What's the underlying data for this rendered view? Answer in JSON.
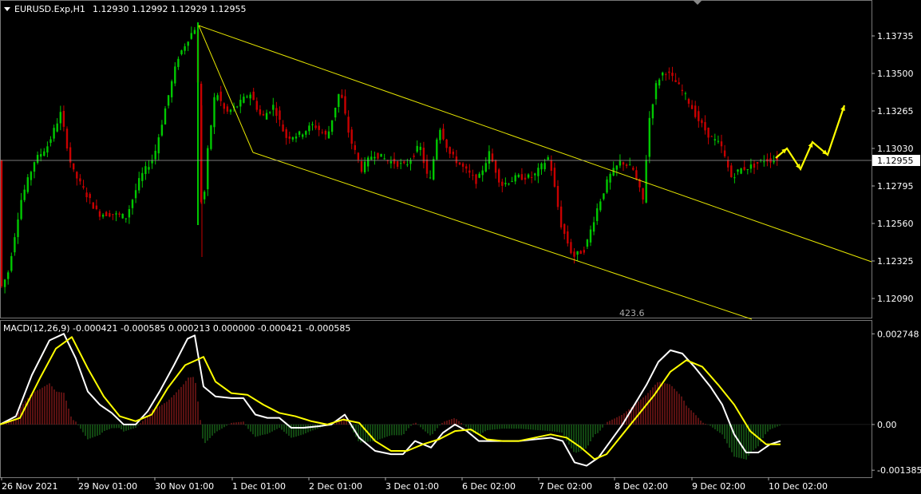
{
  "header": {
    "symbol": "EURUSD.Exp,H1",
    "ohlc": "1.12930 1.12992 1.12929 1.12955"
  },
  "macd_header": "MACD(12,26,9) -0.000421 -0.000585 0.000213 0.000000 -0.000421 -0.000585",
  "chart_label": "423.6",
  "colors": {
    "background": "#000000",
    "bull": "#00c800",
    "bear": "#c80000",
    "channel": "#e6e600",
    "arrow": "#ffff00",
    "macd_line": "#ffffff",
    "signal_line": "#ffff00",
    "hist_pos": "#b22222",
    "hist_neg": "#228b22",
    "bid_line": "#a0a0a0"
  },
  "chart_data": [
    {
      "type": "candlestick",
      "title": "EURUSD.Exp,H1",
      "y_ticks": [
        1.1209,
        1.12325,
        1.1256,
        1.12795,
        1.1303,
        1.13265,
        1.135,
        1.13735
      ],
      "y_tick_labels": [
        "1.12090",
        "1.12325",
        "1.12560",
        "1.12795",
        "1.13030",
        "1.13265",
        "1.13500",
        "1.13735"
      ],
      "ylim": [
        1.12,
        1.1385
      ],
      "current_price": 1.12955,
      "current_price_label": "1.12955",
      "price_path": [
        [
          0,
          1.1212
        ],
        [
          12,
          1.1225
        ],
        [
          28,
          1.127
        ],
        [
          45,
          1.1295
        ],
        [
          62,
          1.1305
        ],
        [
          78,
          1.1325
        ],
        [
          92,
          1.129
        ],
        [
          108,
          1.1276
        ],
        [
          125,
          1.1262
        ],
        [
          142,
          1.1262
        ],
        [
          160,
          1.126
        ],
        [
          178,
          1.1285
        ],
        [
          195,
          1.1298
        ],
        [
          210,
          1.133
        ],
        [
          225,
          1.136
        ],
        [
          238,
          1.1372
        ],
        [
          248,
          1.138
        ],
        [
          255,
          1.1255
        ],
        [
          262,
          1.13
        ],
        [
          272,
          1.134
        ],
        [
          285,
          1.1325
        ],
        [
          300,
          1.133
        ],
        [
          315,
          1.1338
        ],
        [
          330,
          1.1322
        ],
        [
          345,
          1.133
        ],
        [
          360,
          1.131
        ],
        [
          378,
          1.1312
        ],
        [
          395,
          1.1318
        ],
        [
          412,
          1.131
        ],
        [
          428,
          1.134
        ],
        [
          440,
          1.131
        ],
        [
          455,
          1.129
        ],
        [
          470,
          1.13
        ],
        [
          490,
          1.1295
        ],
        [
          510,
          1.1292
        ],
        [
          528,
          1.1305
        ],
        [
          540,
          1.128
        ],
        [
          552,
          1.1318
        ],
        [
          565,
          1.13
        ],
        [
          580,
          1.1292
        ],
        [
          600,
          1.1282
        ],
        [
          615,
          1.13
        ],
        [
          630,
          1.128
        ],
        [
          650,
          1.1285
        ],
        [
          670,
          1.1285
        ],
        [
          690,
          1.1298
        ],
        [
          705,
          1.1255
        ],
        [
          720,
          1.1235
        ],
        [
          735,
          1.124
        ],
        [
          750,
          1.1265
        ],
        [
          765,
          1.1285
        ],
        [
          780,
          1.1295
        ],
        [
          795,
          1.129
        ],
        [
          808,
          1.127
        ],
        [
          815,
          1.132
        ],
        [
          825,
          1.1345
        ],
        [
          835,
          1.1352
        ],
        [
          848,
          1.1345
        ],
        [
          862,
          1.1335
        ],
        [
          878,
          1.132
        ],
        [
          892,
          1.131
        ],
        [
          905,
          1.1305
        ],
        [
          918,
          1.1285
        ],
        [
          930,
          1.129
        ],
        [
          945,
          1.1292
        ],
        [
          960,
          1.1296
        ],
        [
          975,
          1.12955
        ]
      ],
      "channel": {
        "upper": [
          [
            249,
            1.138
          ],
          [
            1092,
            1.1232
          ]
        ],
        "lower": [
          [
            317,
            1.13005
          ],
          [
            942,
            1.1196
          ]
        ],
        "mid_start": [
          [
            317,
            1.13005
          ],
          [
            249,
            1.138
          ]
        ]
      },
      "forecast_arrow": [
        [
          972,
          1.1297
        ],
        [
          986,
          1.1303
        ],
        [
          1003,
          1.129
        ],
        [
          1018,
          1.1307
        ],
        [
          1037,
          1.1299
        ],
        [
          1058,
          1.133
        ]
      ],
      "annotation": {
        "text": "423.6",
        "x": 792,
        "price": 1.1212
      }
    },
    {
      "type": "macd",
      "title": "MACD(12,26,9)",
      "y_ticks": [
        0.002748,
        0.0,
        -0.001385
      ],
      "y_tick_labels": [
        "0.002748",
        "0.00",
        "-0.001385"
      ],
      "ylim": [
        -0.00155,
        0.0029
      ],
      "macd": [
        [
          0,
          0.0
        ],
        [
          20,
          0.00025
        ],
        [
          40,
          0.0015
        ],
        [
          62,
          0.00255
        ],
        [
          80,
          0.00275
        ],
        [
          95,
          0.002
        ],
        [
          110,
          0.001
        ],
        [
          125,
          0.0006
        ],
        [
          140,
          0.00035
        ],
        [
          155,
          0.0
        ],
        [
          170,
          0.0
        ],
        [
          185,
          0.0004
        ],
        [
          200,
          0.001
        ],
        [
          218,
          0.0018
        ],
        [
          235,
          0.0026
        ],
        [
          244,
          0.0027
        ],
        [
          255,
          0.00115
        ],
        [
          270,
          0.00085
        ],
        [
          290,
          0.0008
        ],
        [
          305,
          0.0008
        ],
        [
          320,
          0.0003
        ],
        [
          335,
          0.0002
        ],
        [
          350,
          0.0002
        ],
        [
          365,
          -0.0001
        ],
        [
          380,
          -0.0001
        ],
        [
          400,
          -5e-05
        ],
        [
          415,
          0.0
        ],
        [
          432,
          0.0003
        ],
        [
          450,
          -0.0004
        ],
        [
          470,
          -0.0008
        ],
        [
          490,
          -0.0009
        ],
        [
          505,
          -0.0009
        ],
        [
          520,
          -0.0005
        ],
        [
          540,
          -0.0007
        ],
        [
          555,
          -0.00025
        ],
        [
          570,
          0.0
        ],
        [
          585,
          -0.0002
        ],
        [
          600,
          -0.0005
        ],
        [
          615,
          -0.0005
        ],
        [
          630,
          -0.0005
        ],
        [
          650,
          -0.0005
        ],
        [
          670,
          -0.00045
        ],
        [
          690,
          -0.0004
        ],
        [
          705,
          -0.0005
        ],
        [
          720,
          -0.00115
        ],
        [
          735,
          -0.00125
        ],
        [
          750,
          -0.001
        ],
        [
          765,
          -0.0005
        ],
        [
          780,
          0.0
        ],
        [
          795,
          0.0006
        ],
        [
          810,
          0.0012
        ],
        [
          825,
          0.0019
        ],
        [
          840,
          0.00225
        ],
        [
          855,
          0.00215
        ],
        [
          870,
          0.00175
        ],
        [
          890,
          0.00115
        ],
        [
          905,
          0.0006
        ],
        [
          920,
          -0.0003
        ],
        [
          935,
          -0.00085
        ],
        [
          950,
          -0.00085
        ],
        [
          965,
          -0.0006
        ],
        [
          978,
          -0.0005
        ]
      ],
      "signal": [
        [
          0,
          0.0
        ],
        [
          25,
          0.0002
        ],
        [
          50,
          0.0014
        ],
        [
          70,
          0.0023
        ],
        [
          90,
          0.00265
        ],
        [
          110,
          0.0017
        ],
        [
          130,
          0.00085
        ],
        [
          150,
          0.00025
        ],
        [
          170,
          0.0001
        ],
        [
          190,
          0.0003
        ],
        [
          210,
          0.0011
        ],
        [
          232,
          0.0018
        ],
        [
          255,
          0.00205
        ],
        [
          270,
          0.0013
        ],
        [
          290,
          0.00095
        ],
        [
          310,
          0.0009
        ],
        [
          330,
          0.0006
        ],
        [
          350,
          0.00035
        ],
        [
          370,
          0.00025
        ],
        [
          390,
          0.0001
        ],
        [
          410,
          0.0
        ],
        [
          430,
          0.00015
        ],
        [
          450,
          5e-05
        ],
        [
          470,
          -0.0005
        ],
        [
          490,
          -0.0008
        ],
        [
          510,
          -0.0008
        ],
        [
          530,
          -0.0006
        ],
        [
          550,
          -0.00045
        ],
        [
          570,
          -0.0002
        ],
        [
          590,
          -0.00015
        ],
        [
          610,
          -0.00045
        ],
        [
          630,
          -0.0005
        ],
        [
          650,
          -0.0005
        ],
        [
          670,
          -0.0004
        ],
        [
          690,
          -0.0003
        ],
        [
          710,
          -0.0004
        ],
        [
          728,
          -0.0007
        ],
        [
          745,
          -0.00105
        ],
        [
          760,
          -0.0009
        ],
        [
          780,
          -0.0003
        ],
        [
          800,
          0.0003
        ],
        [
          820,
          0.0009
        ],
        [
          840,
          0.0016
        ],
        [
          860,
          0.00195
        ],
        [
          880,
          0.00175
        ],
        [
          900,
          0.0012
        ],
        [
          920,
          0.0006
        ],
        [
          940,
          -0.0002
        ],
        [
          960,
          -0.0006
        ],
        [
          978,
          -0.0006
        ]
      ]
    }
  ],
  "x_labels": [
    {
      "text": "26 Nov 2021",
      "x": 0
    },
    {
      "text": "29 Nov 01:00",
      "x": 96
    },
    {
      "text": "30 Nov 01:00",
      "x": 192
    },
    {
      "text": "1 Dec 01:00",
      "x": 289
    },
    {
      "text": "2 Dec 01:00",
      "x": 385
    },
    {
      "text": "3 Dec 01:00",
      "x": 481
    },
    {
      "text": "6 Dec 02:00",
      "x": 577
    },
    {
      "text": "7 Dec 02:00",
      "x": 673
    },
    {
      "text": "8 Dec 02:00",
      "x": 768
    },
    {
      "text": "9 Dec 02:00",
      "x": 865
    },
    {
      "text": "10 Dec 02:00",
      "x": 961
    }
  ]
}
